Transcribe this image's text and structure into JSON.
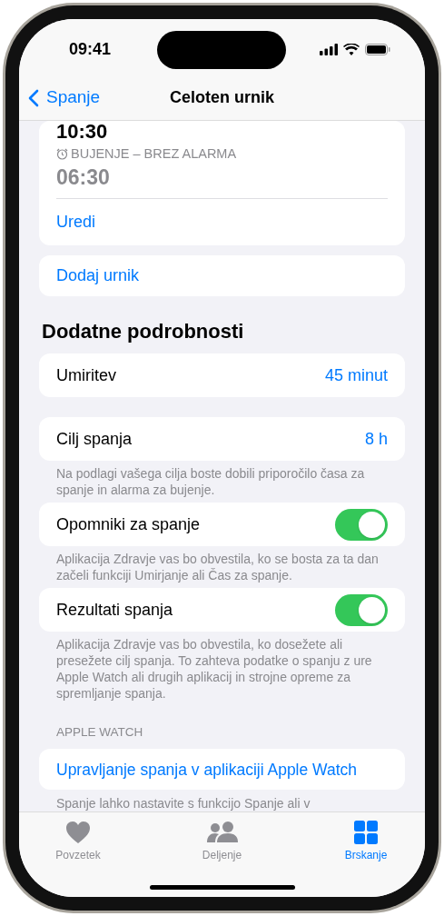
{
  "status_bar": {
    "time": "09:41"
  },
  "nav": {
    "back": "Spanje",
    "title": "Celoten urnik"
  },
  "schedule_card": {
    "bedtime": "10:30",
    "wake_label": "BUJENJE – BREZ ALARMA",
    "wake_time": "06:30",
    "edit": "Uredi"
  },
  "add_schedule": "Dodaj urnik",
  "section_title": "Dodatne podrobnosti",
  "rows": [
    {
      "kind": "value",
      "label": "Umiritev",
      "value": "45 minut"
    },
    {
      "kind": "value",
      "label": "Cilj spanja",
      "value": "8 h",
      "footer": "Na podlagi vašega cilja boste dobili priporočilo časa za spanje in alarma za bujenje."
    },
    {
      "kind": "toggle",
      "label": "Opomniki za spanje",
      "on": true,
      "footer": "Aplikacija Zdravje vas bo obvestila, ko se bosta za ta dan začeli funkciji Umirjanje ali Čas za spanje."
    },
    {
      "kind": "toggle",
      "label": "Rezultati spanja",
      "on": true,
      "footer": "Aplikacija Zdravje vas bo obvestila, ko dosežete ali presežete cilj spanja. To zahteva podatke o spanju z ure Apple Watch ali drugih aplikacij in strojne opreme za spremljanje spanja."
    }
  ],
  "apple_watch": {
    "header": "APPLE WATCH",
    "link": "Upravljanje spanja v aplikaciji Apple Watch",
    "footer": "Spanje lahko nastavite s funkcijo Spanje ali v"
  },
  "tabs": [
    {
      "kind": "heart",
      "label": "Povzetek",
      "selected": false
    },
    {
      "kind": "people",
      "label": "Deljenje",
      "selected": false
    },
    {
      "kind": "grid",
      "label": "Brskanje",
      "selected": true
    }
  ]
}
